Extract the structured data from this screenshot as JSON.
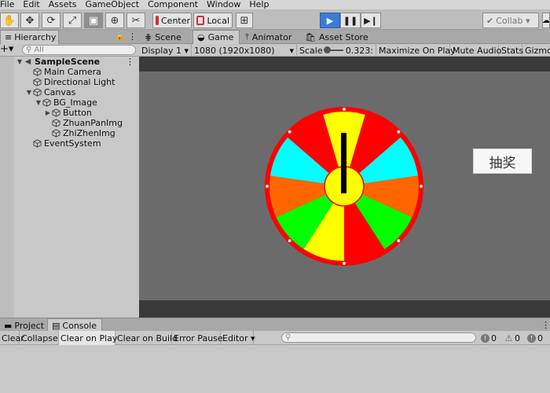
{
  "menu": [
    "File",
    "Edit",
    "Assets",
    "GameObject",
    "Component",
    "Window",
    "Help"
  ],
  "toolbar": {
    "pivot_label": "Center",
    "space_label": "Local",
    "collab_label": "Collab ▾"
  },
  "hierarchy": {
    "tab_label": "Hierarchy",
    "search_placeholder": "All",
    "items": [
      {
        "label": "SampleScene",
        "depth": 0,
        "expanded": true,
        "type": "scene"
      },
      {
        "label": "Main Camera",
        "depth": 1,
        "type": "object"
      },
      {
        "label": "Directional Light",
        "depth": 1,
        "type": "object"
      },
      {
        "label": "Canvas",
        "depth": 1,
        "expanded": true,
        "type": "object"
      },
      {
        "label": "BG_Image",
        "depth": 2,
        "expanded": true,
        "type": "object"
      },
      {
        "label": "Button",
        "depth": 3,
        "collapsed": true,
        "type": "object"
      },
      {
        "label": "ZhuanPanImg",
        "depth": 3,
        "type": "object"
      },
      {
        "label": "ZhiZhenImg",
        "depth": 3,
        "type": "object"
      },
      {
        "label": "EventSystem",
        "depth": 1,
        "type": "object"
      }
    ]
  },
  "view_tabs": {
    "scene": "Scene",
    "game": "Game",
    "animator": "Animator",
    "asset_store": "Asset Store"
  },
  "game_controls": {
    "display": "Display 1",
    "resolution": "1080 (1920x1080)",
    "scale_label": "Scale",
    "scale_value": "0.323:",
    "maximize": "Maximize On Play",
    "mute": "Mute Audio",
    "stats": "Stats",
    "gizmos": "Gizmo"
  },
  "game_view": {
    "button_label": "抽奖",
    "wheel_colors": [
      "#ffff00",
      "#ff0000",
      "#00ffff",
      "#ff6600",
      "#00ff00",
      "#ff0000",
      "#ffff00",
      "#00ff00",
      "#ff6600",
      "#00ffff",
      "#ff0000"
    ],
    "rim_color": "#ff0000",
    "pointer_color": "#000000"
  },
  "console": {
    "project_tab": "Project",
    "console_tab": "Console",
    "buttons": {
      "clear": "Clear",
      "collapse": "Collapse",
      "clear_on_play": "Clear on Play",
      "clear_on_build": "Clear on Build",
      "error_pause": "Error Pause",
      "editor": "Editor ▾"
    },
    "counts": {
      "log": "0",
      "warning": "0",
      "error": "0"
    }
  }
}
